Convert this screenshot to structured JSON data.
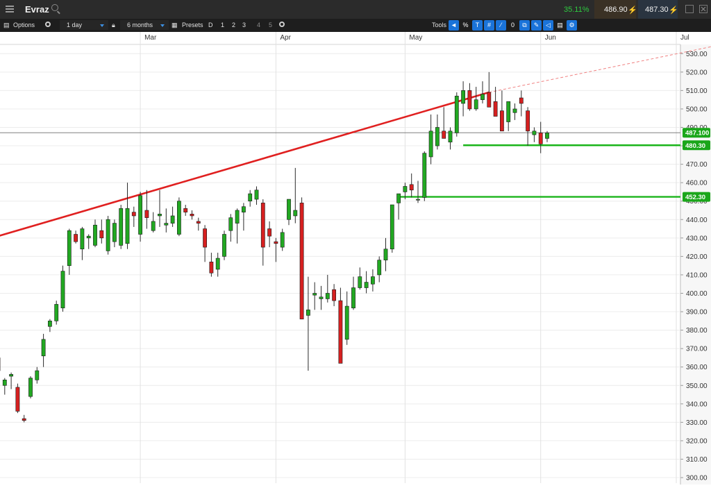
{
  "header": {
    "instrument": "Evraz",
    "change_pct": "35.11%",
    "sell_price": "486.90",
    "buy_price": "487.30",
    "change_color": "#2ecc40"
  },
  "toolbar": {
    "options_label": "Options",
    "interval_value": "1 day",
    "range_value": "6 months",
    "presets_label": "Presets",
    "preset_items": [
      "D",
      "1",
      "2",
      "3",
      "4",
      "5"
    ],
    "tools_label": "Tools",
    "tool_items": [
      {
        "icon": "cursor-arrow-icon",
        "glyph": "◄",
        "active": true
      },
      {
        "icon": "percent-icon",
        "glyph": "%",
        "active": false
      },
      {
        "icon": "text-tool-icon",
        "glyph": "T",
        "active": true
      },
      {
        "icon": "grid-icon",
        "glyph": "#",
        "active": true
      },
      {
        "icon": "draw-tool-icon",
        "glyph": "⁄",
        "active": true
      },
      {
        "icon": "zero-icon",
        "glyph": "0",
        "active": false
      },
      {
        "icon": "copy-icon",
        "glyph": "⧉",
        "active": true
      },
      {
        "icon": "pen-icon",
        "glyph": "✎",
        "active": true
      },
      {
        "icon": "label-icon",
        "glyph": "◁",
        "active": true
      },
      {
        "icon": "print-icon",
        "glyph": "▤",
        "active": false
      },
      {
        "icon": "settings-link-icon",
        "glyph": "⚙",
        "active": true
      }
    ]
  },
  "chart_data": {
    "type": "candlestick",
    "x_axis": {
      "month_labels": [
        {
          "label": "Mar",
          "day": 22
        },
        {
          "label": "Apr",
          "day": 43
        },
        {
          "label": "May",
          "day": 63
        },
        {
          "label": "Jun",
          "day": 84
        },
        {
          "label": "Jul",
          "day": 105
        }
      ]
    },
    "y_axis": {
      "min": 297,
      "max": 535,
      "ticks": [
        300,
        310,
        320,
        330,
        340,
        350,
        360,
        370,
        380,
        390,
        400,
        410,
        420,
        430,
        440,
        450,
        460,
        470,
        480,
        490,
        500,
        510,
        520,
        530
      ],
      "tick_format": "2dp"
    },
    "grid": true,
    "colors": {
      "up": "#22a822",
      "down": "#d62020",
      "trendline": "#e02020",
      "level": "#19b419"
    },
    "candles": [
      [
        0,
        365,
        368,
        355,
        358
      ],
      [
        1,
        350,
        354,
        345,
        353
      ],
      [
        2,
        355,
        357,
        348,
        356
      ],
      [
        3,
        349,
        351,
        335,
        336
      ],
      [
        4,
        332,
        334,
        330,
        331
      ],
      [
        5,
        344,
        355,
        343,
        354
      ],
      [
        6,
        353,
        360,
        351,
        358
      ],
      [
        7,
        366,
        378,
        360,
        375
      ],
      [
        8,
        382,
        386,
        379,
        385
      ],
      [
        9,
        385,
        396,
        383,
        394
      ],
      [
        10,
        392,
        415,
        390,
        412
      ],
      [
        11,
        415,
        435,
        410,
        434
      ],
      [
        12,
        432,
        434,
        427,
        428
      ],
      [
        13,
        424,
        436,
        418,
        435
      ],
      [
        14,
        430,
        432,
        424,
        431
      ],
      [
        15,
        426,
        440,
        425,
        437
      ],
      [
        16,
        434,
        440,
        427,
        430
      ],
      [
        17,
        423,
        442,
        421,
        440
      ],
      [
        18,
        428,
        440,
        425,
        438
      ],
      [
        19,
        426,
        448,
        424,
        446
      ],
      [
        20,
        427,
        460,
        424,
        446
      ],
      [
        21,
        444,
        447,
        436,
        442
      ],
      [
        22,
        432,
        455,
        428,
        453
      ],
      [
        23,
        445,
        456,
        435,
        441
      ],
      [
        24,
        434,
        444,
        433,
        439
      ],
      [
        25,
        442,
        456,
        436,
        443
      ],
      [
        26,
        437,
        446,
        433,
        438
      ],
      [
        27,
        438,
        447,
        436,
        442
      ],
      [
        28,
        432,
        452,
        431,
        450
      ],
      [
        29,
        446,
        448,
        442,
        444
      ],
      [
        30,
        443,
        445,
        440,
        442
      ],
      [
        31,
        439,
        441,
        434,
        438
      ],
      [
        32,
        435,
        437,
        417,
        425
      ],
      [
        33,
        417,
        422,
        409,
        411
      ],
      [
        34,
        413,
        422,
        409,
        419
      ],
      [
        35,
        420,
        434,
        418,
        432
      ],
      [
        36,
        434,
        443,
        428,
        441
      ],
      [
        37,
        438,
        446,
        427,
        445
      ],
      [
        38,
        444,
        449,
        434,
        447
      ],
      [
        39,
        450,
        456,
        447,
        454
      ],
      [
        40,
        451,
        458,
        448,
        456
      ],
      [
        41,
        449,
        451,
        415,
        425
      ],
      [
        42,
        435,
        439,
        425,
        431
      ],
      [
        43,
        428,
        430,
        417,
        427
      ],
      [
        44,
        425,
        435,
        423,
        433
      ],
      [
        45,
        440,
        451,
        437,
        451
      ],
      [
        46,
        442,
        468,
        438,
        445
      ],
      [
        47,
        449,
        452,
        387,
        386
      ],
      [
        48,
        388,
        409,
        358,
        391
      ],
      [
        49,
        399,
        406,
        391,
        400
      ],
      [
        50,
        397,
        404,
        391,
        398
      ],
      [
        51,
        397,
        410,
        395,
        400
      ],
      [
        52,
        402,
        405,
        393,
        396
      ],
      [
        53,
        396,
        403,
        382,
        362
      ],
      [
        54,
        375,
        401,
        372,
        393
      ],
      [
        55,
        392,
        409,
        391,
        403
      ],
      [
        56,
        403,
        414,
        402,
        409
      ],
      [
        57,
        403,
        412,
        400,
        406
      ],
      [
        58,
        405,
        413,
        401,
        409
      ],
      [
        59,
        410,
        420,
        406,
        418
      ],
      [
        60,
        418,
        430,
        412,
        424
      ],
      [
        61,
        424,
        448,
        422,
        448
      ],
      [
        62,
        449,
        453,
        440,
        454
      ],
      [
        63,
        455,
        460,
        451,
        458
      ],
      [
        64,
        459,
        465,
        452,
        456
      ],
      [
        65,
        451,
        461,
        449,
        451
      ],
      [
        66,
        452,
        477,
        450,
        476
      ],
      [
        67,
        474,
        497,
        470,
        488
      ],
      [
        68,
        480,
        497,
        478,
        490
      ],
      [
        69,
        488,
        501,
        485,
        484
      ],
      [
        70,
        482,
        490,
        478,
        488
      ],
      [
        71,
        487,
        509,
        485,
        507
      ],
      [
        72,
        503,
        515,
        496,
        510
      ],
      [
        73,
        510,
        514,
        499,
        500
      ],
      [
        74,
        500,
        512,
        499,
        505
      ],
      [
        75,
        505,
        515,
        503,
        508
      ],
      [
        76,
        509,
        520,
        502,
        501
      ],
      [
        77,
        504,
        512,
        500,
        496
      ],
      [
        78,
        499,
        510,
        496,
        488
      ],
      [
        79,
        493,
        503,
        488,
        504
      ],
      [
        80,
        498,
        503,
        494,
        500
      ],
      [
        81,
        506,
        510,
        496,
        503
      ],
      [
        82,
        499,
        501,
        480,
        488
      ],
      [
        83,
        486,
        490,
        482,
        488
      ],
      [
        84,
        487,
        493,
        476,
        481
      ],
      [
        85,
        484,
        488,
        482,
        487
      ]
    ],
    "trendline": {
      "start": [
        -1,
        430
      ],
      "end": [
        76,
        509
      ],
      "extend_to": [
        126,
        545
      ]
    },
    "levels": [
      {
        "value": 480.3,
        "label": "480.30",
        "from_day": 72
      },
      {
        "value": 452.3,
        "label": "452.30",
        "from_day": 62
      }
    ],
    "current_price": {
      "value": 487.1,
      "label": "487.100"
    }
  }
}
